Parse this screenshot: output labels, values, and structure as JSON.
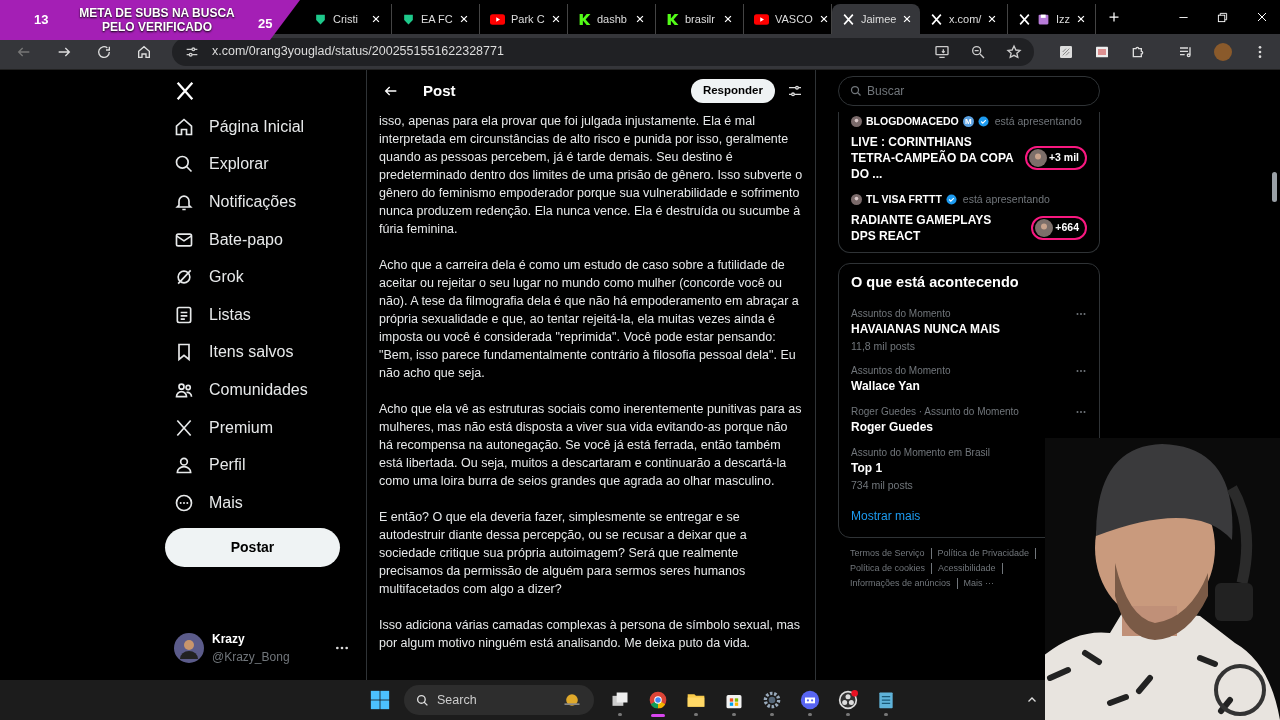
{
  "stream_overlay": {
    "left_count": "13",
    "goal": "META DE SUBS NA BUSCA PELO VERIFICADO",
    "right_count": "25"
  },
  "browser": {
    "tabs": [
      {
        "title": "Cristi",
        "kind": "fc",
        "selected": false
      },
      {
        "title": "EA FC",
        "kind": "fc",
        "selected": false
      },
      {
        "title": "Park C",
        "kind": "youtube",
        "selected": false
      },
      {
        "title": "dashb",
        "kind": "k",
        "selected": false
      },
      {
        "title": "brasilr",
        "kind": "k",
        "selected": false
      },
      {
        "title": "VASCO",
        "kind": "youtube",
        "selected": false
      },
      {
        "title": "Jaimee",
        "kind": "x",
        "selected": true
      },
      {
        "title": "x.com/",
        "kind": "x",
        "selected": false
      },
      {
        "title": "Izz",
        "kind": "x-floppy",
        "selected": false
      }
    ],
    "url": "x.com/0rang3youglad/status/2002551551622328771"
  },
  "nav": {
    "items": [
      {
        "label": "Página Inicial",
        "kind": "home"
      },
      {
        "label": "Explorar",
        "kind": "search"
      },
      {
        "label": "Notificações",
        "kind": "bell"
      },
      {
        "label": "Bate-papo",
        "kind": "mail"
      },
      {
        "label": "Grok",
        "kind": "grok"
      },
      {
        "label": "Listas",
        "kind": "list"
      },
      {
        "label": "Itens salvos",
        "kind": "bookmark"
      },
      {
        "label": "Comunidades",
        "kind": "people"
      },
      {
        "label": "Premium",
        "kind": "x"
      },
      {
        "label": "Perfil",
        "kind": "person"
      },
      {
        "label": "Mais",
        "kind": "more"
      }
    ],
    "post_button": "Postar",
    "account": {
      "name": "Krazy",
      "handle": "@Krazy_Bong"
    }
  },
  "post": {
    "title": "Post",
    "reply_button": "Responder",
    "paragraphs": [
      "isso, apenas para ela provar que foi julgada injustamente. Ela é mal interpretada em circunstâncias de alto risco e punida por isso, geralmente quando as pessoas percebem, já é tarde demais. Seu destino é predeterminado dentro dos limites de uma prisão de gênero. Isso subverte o gênero do feminismo empoderador porque sua vulnerabilidade e sofrimento nunca produzem redenção. Ela nunca vence. Ela é destruída ou sucumbe à fúria feminina.",
      "Acho que a carreira dela é como um estudo de caso sobre a futilidade de aceitar ou rejeitar o seu lugar no mundo como mulher (concorde você ou não). A tese da filmografia dela é que não há empoderamento em abraçar a própria sexualidade e que, ao tentar rejeitá-la, ela muitas vezes ainda é imposta ou você é considerada \"reprimida\". Você pode estar pensando: \"Bem, isso parece fundamentalmente contrário à filosofia pessoal dela\". Eu não acho que seja.",
      "Acho que ela vê as estruturas sociais como inerentemente punitivas para as mulheres, mas não está disposta a viver sua vida evitando-as porque não há recompensa na autonegação. Se você já está ferrada, então também está libertada. Ou seja, muitos a descartaram e continuarão a descartá-la como uma loira burra de seios grandes que agrada ao olhar masculino.",
      "E então? O que ela deveria fazer, simplesmente se entregar e se autodestruir diante dessa percepção, ou se recusar a deixar que a sociedade critique sua própria autoimagem? Será que realmente precisamos da permissão de alguém para sermos seres humanos multifacetados com algo a dizer?",
      "Isso adiciona várias camadas complexas à persona de símbolo sexual, mas por algum motivo ninguém está analisando. Me deixa puto da vida."
    ]
  },
  "sidebar": {
    "search": {
      "placeholder": "Buscar"
    },
    "live": [
      {
        "host": "BLOGDOMACEDO",
        "host_badge": "M",
        "status": "está apresentando",
        "title": "LIVE : CORINTHIANS TETRA-CAMPEÃO DA COPA DO ...",
        "viewers": "+3 mil"
      },
      {
        "host": "TL VISA FRTTT",
        "status": "está apresentando",
        "title": "RADIANTE GAMEPLAYS DPS REACT",
        "viewers": "+664"
      }
    ],
    "trends": {
      "title": "O que está acontecendo",
      "items": [
        {
          "context": "Assuntos do Momento",
          "name": "HAVAIANAS NUNCA MAIS",
          "posts": "11,8 mil posts"
        },
        {
          "context": "Assuntos do Momento",
          "name": "Wallace Yan"
        },
        {
          "context": "Roger Guedes · Assunto do Momento",
          "name": "Roger Guedes"
        },
        {
          "context": "Assunto do Momento em Brasil",
          "name": "Top 1",
          "posts": "734 mil posts"
        }
      ],
      "more": "Mostrar mais"
    },
    "footer_links": [
      "Termos de Serviço",
      "Política de Privacidade",
      "Política de cookies",
      "Acessibilidade",
      "Informações de anúncios",
      "Mais ···"
    ]
  },
  "taskbar": {
    "search_placeholder": "Search",
    "apps": [
      {
        "kind": "task-view",
        "selected": false
      },
      {
        "kind": "chrome",
        "selected": true
      },
      {
        "kind": "folder",
        "selected": false
      },
      {
        "kind": "store",
        "selected": false
      },
      {
        "kind": "settings",
        "selected": false
      },
      {
        "kind": "discord",
        "selected": false
      },
      {
        "kind": "obs",
        "selected": false
      },
      {
        "kind": "notepad",
        "selected": false
      }
    ]
  }
}
